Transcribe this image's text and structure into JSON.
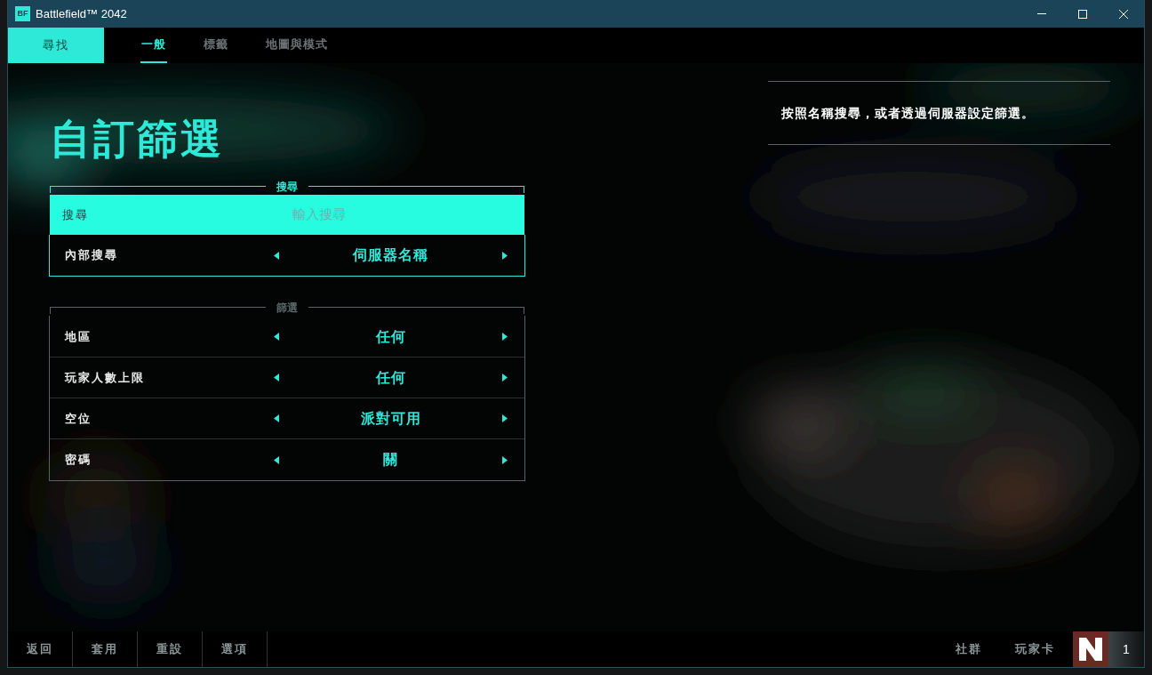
{
  "window": {
    "title": "Battlefield™ 2042",
    "logo": "BF"
  },
  "nav": {
    "primary": "尋找",
    "tabs": [
      {
        "label": "一般",
        "selected": true
      },
      {
        "label": "標籤",
        "selected": false
      },
      {
        "label": "地圖與模式",
        "selected": false
      }
    ]
  },
  "heading": "自訂篩選",
  "search_section": {
    "title": "搜尋",
    "field_label": "搜尋",
    "placeholder": "輸入搜尋",
    "options": [
      {
        "label": "內部搜尋",
        "value": "伺服器名稱"
      }
    ]
  },
  "filter_section": {
    "title": "篩選",
    "options": [
      {
        "label": "地區",
        "value": "任何"
      },
      {
        "label": "玩家人數上限",
        "value": "任何"
      },
      {
        "label": "空位",
        "value": "派對可用"
      },
      {
        "label": "密碼",
        "value": "關"
      }
    ]
  },
  "description": "按照名稱搜尋，或者透過伺服器設定篩選。",
  "footer": {
    "left_buttons": [
      "返回",
      "套用",
      "重設",
      "選項"
    ],
    "right_buttons": [
      "社群",
      "玩家卡"
    ],
    "party_count": "1"
  }
}
